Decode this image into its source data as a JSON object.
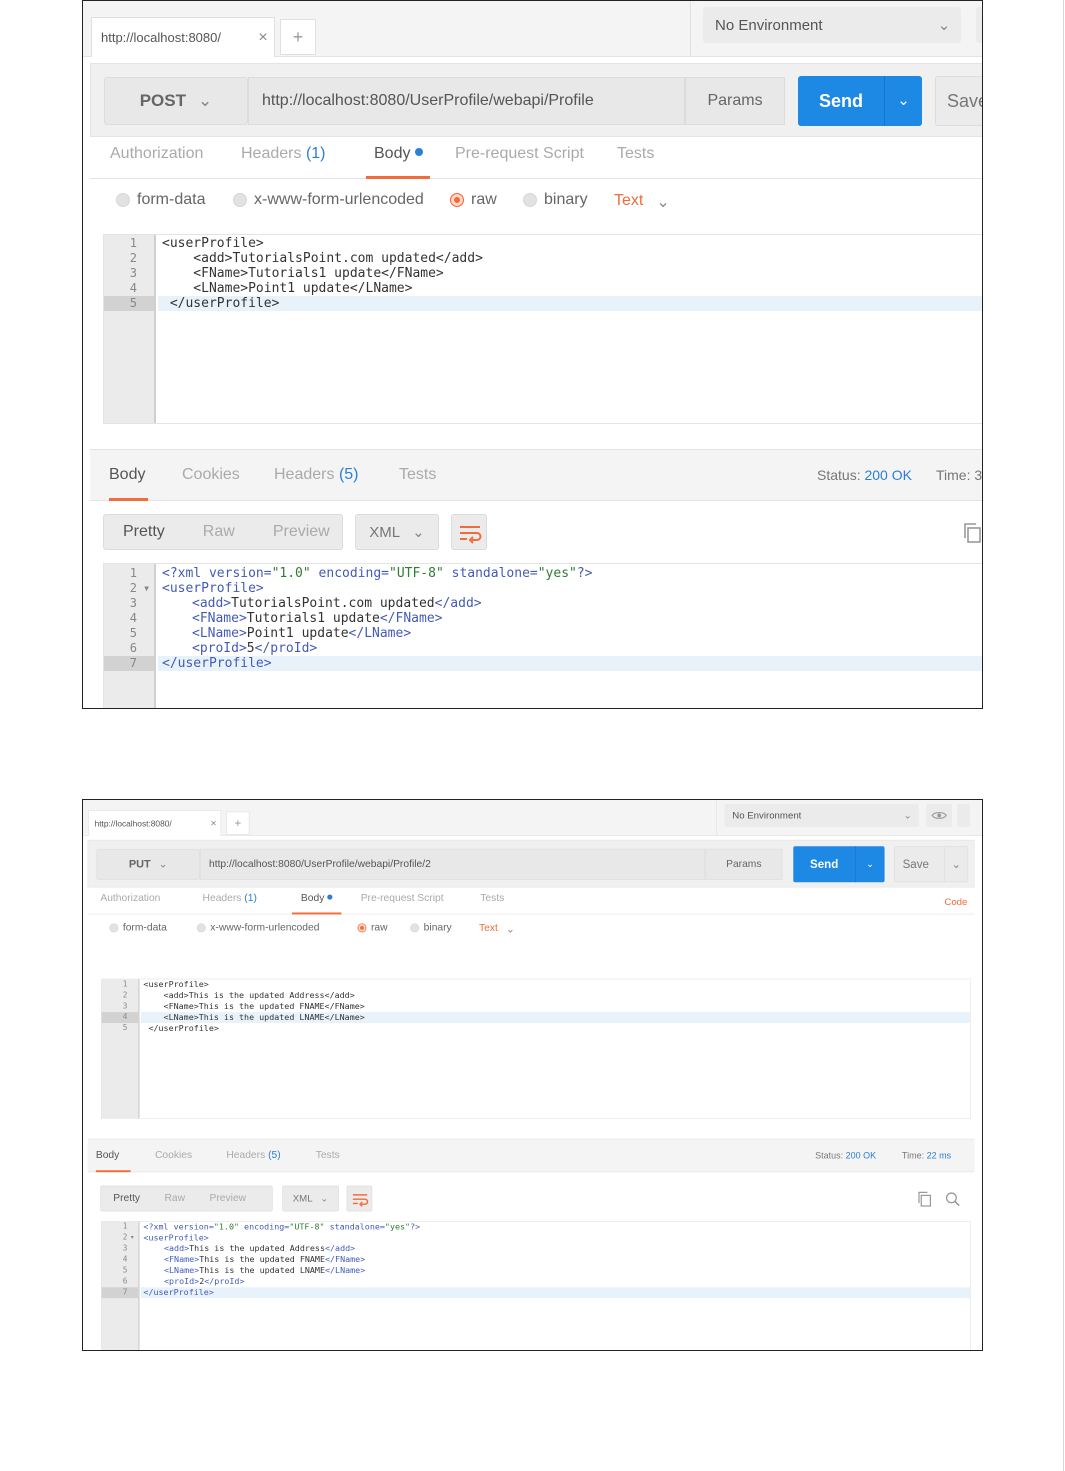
{
  "screens": [
    {
      "tab_url": "http://localhost:8080/",
      "environment": "No Environment",
      "method": "POST",
      "request_url": "http://localhost:8080/UserProfile/webapi/Profile",
      "params_label": "Params",
      "send_label": "Send",
      "save_label": "Save",
      "subtabs": {
        "authorization": "Authorization",
        "headers": "Headers",
        "headers_count": "(1)",
        "body": "Body",
        "prerequest": "Pre-request Script",
        "tests": "Tests"
      },
      "body_modes": {
        "form_data": "form-data",
        "urlencoded": "x-www-form-urlencoded",
        "raw": "raw",
        "binary": "binary",
        "selected": "raw"
      },
      "raw_format": "Text",
      "request_body": {
        "line_numbers": [
          "1",
          "2",
          "3",
          "4",
          "5"
        ],
        "lines": [
          "<userProfile>",
          "    <add>TutorialsPoint.com updated</add>",
          "    <FName>Tutorials1 update</FName>",
          "    <LName>Point1 update</LName>",
          " </userProfile>"
        ],
        "highlighted_line": 5
      },
      "response_tabs": {
        "body": "Body",
        "cookies": "Cookies",
        "headers": "Headers",
        "headers_count": "(5)",
        "tests": "Tests"
      },
      "status_label": "Status:",
      "status_value": "200 OK",
      "time_label": "Time:",
      "time_value": "3",
      "view_modes": [
        "Pretty",
        "Raw",
        "Preview"
      ],
      "active_view": "Pretty",
      "response_format": "XML",
      "response_body": {
        "line_numbers": [
          "1",
          "2",
          "3",
          "4",
          "5",
          "6",
          "7"
        ],
        "fold_marker": "▾",
        "xml_decl": {
          "pre": "<?xml version=",
          "v1": "\"1.0\"",
          "mid1": " encoding=",
          "v2": "\"UTF-8\"",
          "mid2": " standalone=",
          "v3": "\"yes\"",
          "post": "?>"
        },
        "root_open": "<userProfile>",
        "root_close": "</userProfile>",
        "rows": [
          {
            "open": "<add>",
            "text": "TutorialsPoint.com updated",
            "close": "</add>"
          },
          {
            "open": "<FName>",
            "text": "Tutorials1 update",
            "close": "</FName>"
          },
          {
            "open": "<LName>",
            "text": "Point1 update",
            "close": "</LName>"
          },
          {
            "open": "<proId>",
            "text": "5",
            "close": "</proId>"
          }
        ],
        "highlighted_line": 7
      }
    },
    {
      "tab_url": "http://localhost:8080/",
      "environment": "No Environment",
      "method": "PUT",
      "request_url": "http://localhost:8080/UserProfile/webapi/Profile/2",
      "params_label": "Params",
      "send_label": "Send",
      "save_label": "Save",
      "code_label": "Code",
      "subtabs": {
        "authorization": "Authorization",
        "headers": "Headers",
        "headers_count": "(1)",
        "body": "Body",
        "prerequest": "Pre-request Script",
        "tests": "Tests"
      },
      "body_modes": {
        "form_data": "form-data",
        "urlencoded": "x-www-form-urlencoded",
        "raw": "raw",
        "binary": "binary",
        "selected": "raw"
      },
      "raw_format": "Text",
      "request_body": {
        "line_numbers": [
          "1",
          "2",
          "3",
          "4",
          "5"
        ],
        "lines": [
          "<userProfile>",
          "    <add>This is the updated Address</add>",
          "    <FName>This is the updated FNAME</FName>",
          "    <LName>This is the updated LNAME</LName>",
          " </userProfile>"
        ],
        "highlighted_line": 4
      },
      "response_tabs": {
        "body": "Body",
        "cookies": "Cookies",
        "headers": "Headers",
        "headers_count": "(5)",
        "tests": "Tests"
      },
      "status_label": "Status:",
      "status_value": "200 OK",
      "time_label": "Time:",
      "time_value": "22 ms",
      "view_modes": [
        "Pretty",
        "Raw",
        "Preview"
      ],
      "active_view": "Pretty",
      "response_format": "XML",
      "response_body": {
        "line_numbers": [
          "1",
          "2",
          "3",
          "4",
          "5",
          "6",
          "7"
        ],
        "fold_marker": "▾",
        "xml_decl": {
          "pre": "<?xml version=",
          "v1": "\"1.0\"",
          "mid1": " encoding=",
          "v2": "\"UTF-8\"",
          "mid2": " standalone=",
          "v3": "\"yes\"",
          "post": "?>"
        },
        "root_open": "<userProfile>",
        "root_close": "</userProfile>",
        "rows": [
          {
            "open": "<add>",
            "text": "This is the updated Address",
            "close": "</add>"
          },
          {
            "open": "<FName>",
            "text": "This is the updated FNAME",
            "close": "</FName>"
          },
          {
            "open": "<LName>",
            "text": "This is the updated LNAME",
            "close": "</LName>"
          },
          {
            "open": "<proId>",
            "text": "2",
            "close": "</proId>"
          }
        ],
        "highlighted_line": 7
      }
    }
  ],
  "icons": {
    "close_tab": "close-icon",
    "add_tab": "plus-icon",
    "dropdown": "chevron-down-icon",
    "eye": "eye-icon",
    "wrap": "wrap-lines-icon",
    "copy": "copy-icon",
    "search": "search-icon"
  },
  "colors": {
    "send": "#1e88e5",
    "accent": "#f26b3a",
    "link": "#2a80d2"
  }
}
